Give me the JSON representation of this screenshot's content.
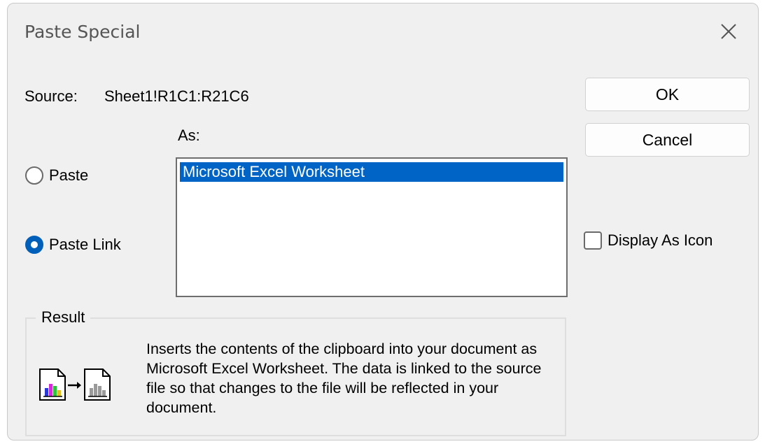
{
  "dialog": {
    "title": "Paste Special",
    "close_icon": "close-icon"
  },
  "source": {
    "label": "Source:",
    "value": "Sheet1!R1C1:R21C6"
  },
  "as_label": "As:",
  "options": {
    "paste_label": "Paste",
    "paste_checked": false,
    "paste_link_label": "Paste Link",
    "paste_link_checked": true
  },
  "list": {
    "items": [
      "Microsoft Excel Worksheet"
    ],
    "selected": "Microsoft Excel Worksheet"
  },
  "buttons": {
    "ok": "OK",
    "cancel": "Cancel"
  },
  "display_as_icon": {
    "label": "Display As Icon",
    "checked": false
  },
  "result": {
    "legend": "Result",
    "text": "Inserts the contents of the clipboard into your document as Microsoft Excel Worksheet.  The data is linked to the source file so that changes to the file will be reflected in your document.",
    "icon": "paste-link-result-icon"
  },
  "colors": {
    "accent": "#005fb8",
    "selection": "#0063c6",
    "dialog_bg": "#f0f0f0"
  }
}
